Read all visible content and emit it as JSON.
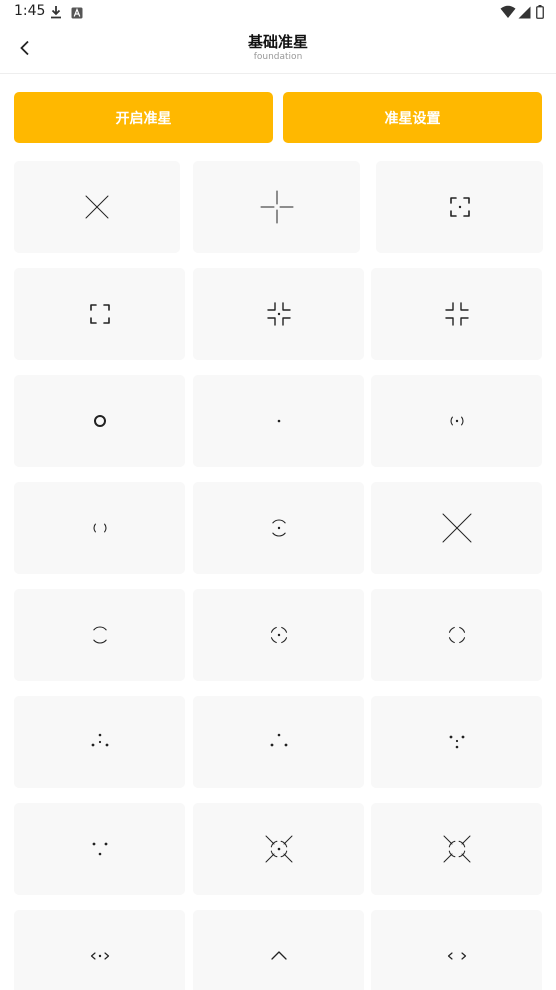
{
  "status_bar": {
    "time": "1:45",
    "left_icons": [
      "download-icon",
      "a-icon"
    ],
    "right_icons": [
      "wifi-icon",
      "cell-signal-icon",
      "battery-icon"
    ]
  },
  "header": {
    "title": "基础准星",
    "subtitle": "foundation",
    "back_icon": "back-arrow-icon"
  },
  "actions": {
    "enable_label": "开启准星",
    "settings_label": "准星设置",
    "accent": "#FFB800"
  },
  "crosshairs": [
    {
      "icon": "x-cross"
    },
    {
      "icon": "plus-cross"
    },
    {
      "icon": "corner-brackets-dot"
    },
    {
      "icon": "corner-brackets"
    },
    {
      "icon": "inner-corners-dot"
    },
    {
      "icon": "inner-corners"
    },
    {
      "icon": "ring"
    },
    {
      "icon": "dot"
    },
    {
      "icon": "paren-dot"
    },
    {
      "icon": "paren"
    },
    {
      "icon": "square-bracket-dot"
    },
    {
      "icon": "big-x"
    },
    {
      "icon": "square-bracket"
    },
    {
      "icon": "dashed-circle-dot"
    },
    {
      "icon": "dashed-circle"
    },
    {
      "icon": "triangle-dots-dot"
    },
    {
      "icon": "triangle-dots"
    },
    {
      "icon": "inverted-triangle-dot"
    },
    {
      "icon": "inverted-triangle"
    },
    {
      "icon": "burst-circle-dot"
    },
    {
      "icon": "burst-circle"
    },
    {
      "icon": "angle-dot"
    },
    {
      "icon": "caret-up"
    },
    {
      "icon": "angle-pair"
    }
  ]
}
